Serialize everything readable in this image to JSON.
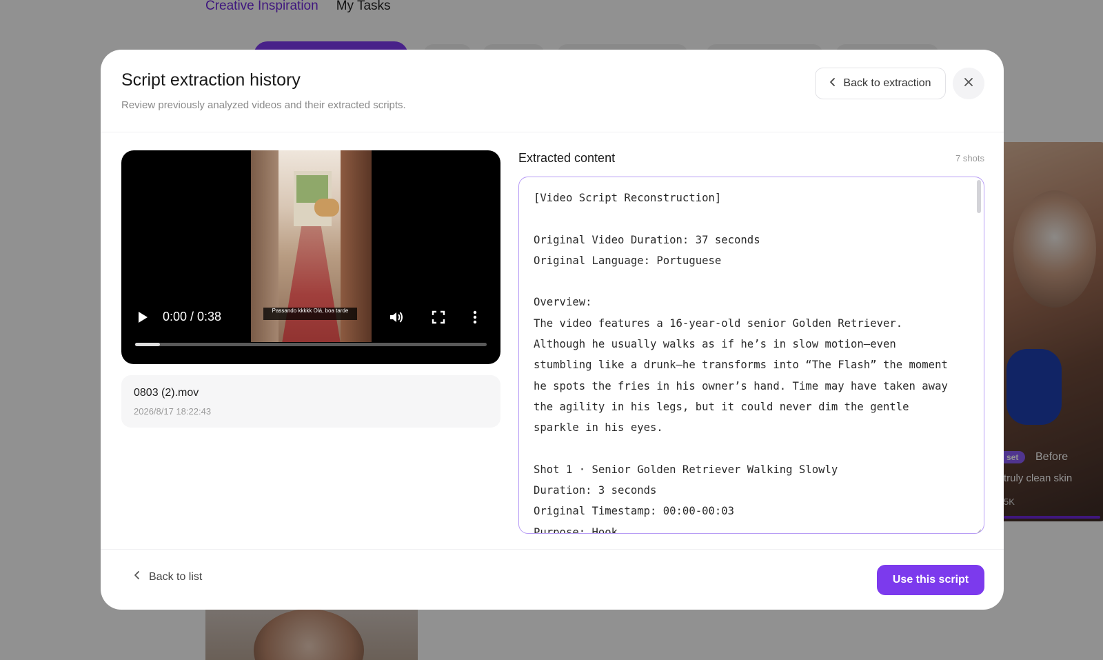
{
  "background": {
    "nav": {
      "tab_active": "Creative Inspiration",
      "tab_inactive": "My Tasks"
    },
    "card": {
      "tag": "set",
      "before_label": "Before",
      "caption": "truly clean skin",
      "count": "5K"
    }
  },
  "modal": {
    "title": "Script extraction history",
    "subtitle": "Review previously analyzed videos and their extracted scripts.",
    "back_to_extraction_label": "Back to extraction",
    "close_icon": "close-icon"
  },
  "video": {
    "time_display": "0:00 / 0:38",
    "progress_fraction": 0.07,
    "burned_caption": "Passando kkkkk Olá, boa tarde"
  },
  "file": {
    "name": "0803 (2).mov",
    "date": "2026/8/17 18:22:43"
  },
  "content": {
    "title": "Extracted content",
    "shots_count": "7 shots",
    "script_text": "[Video Script Reconstruction]\n\nOriginal Video Duration: 37 seconds\nOriginal Language: Portuguese\n\nOverview:\nThe video features a 16-year-old senior Golden Retriever. Although he usually walks as if he’s in slow motion—even stumbling like a drunk—he transforms into “The Flash” the moment he spots the fries in his owner’s hand. Time may have taken away the agility in his legs, but it could never dim the gentle sparkle in his eyes.\n\nShot 1 · Senior Golden Retriever Walking Slowly\nDuration: 3 seconds\nOriginal Timestamp: 00:00-00:03\nPurpose: Hook"
  },
  "footer": {
    "back_to_list_label": "Back to list",
    "use_script_label": "Use this script"
  },
  "colors": {
    "accent": "#7c3aed",
    "accent_border": "#b79cf5"
  }
}
